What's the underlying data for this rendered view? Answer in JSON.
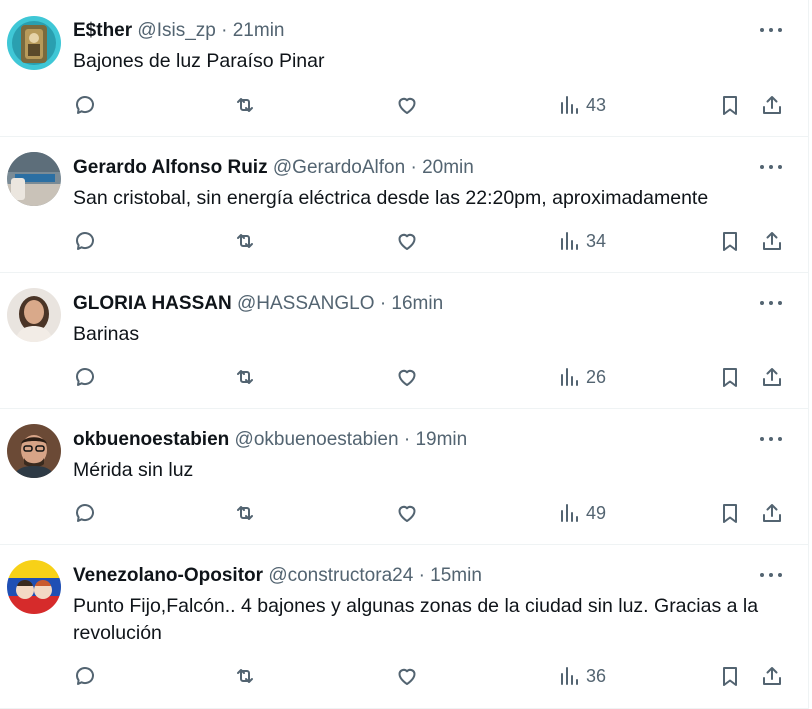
{
  "colors": {
    "text": "#0f1419",
    "secondary": "#536471",
    "divider": "#eff3f4"
  },
  "icons": {
    "reply": "reply-icon",
    "retweet": "retweet-icon",
    "like": "heart-icon",
    "views": "views-icon",
    "bookmark": "bookmark-icon",
    "share": "share-icon",
    "more": "more-icon"
  },
  "tweets": [
    {
      "name": "E$ther",
      "handle": "@Isis_zp",
      "sep": "·",
      "time": "21min",
      "text": "Bajones de luz Paraíso Pinar",
      "views": "43"
    },
    {
      "name": "Gerardo Alfonso Ruiz",
      "handle": "@GerardoAlfon",
      "sep": "·",
      "time": "20min",
      "text": "San cristobal,  sin energía eléctrica desde las 22:20pm, aproximadamente",
      "views": "34"
    },
    {
      "name": "GLORIA HASSAN",
      "handle": "@HASSANGLO",
      "sep": "·",
      "time": "16min",
      "text": "Barinas",
      "views": "26"
    },
    {
      "name": "okbuenoestabien",
      "handle": "@okbuenoestabien",
      "sep": "·",
      "time": "19min",
      "text": "Mérida sin luz",
      "views": "49"
    },
    {
      "name": "Venezolano-Opositor",
      "handle": "@constructora24",
      "sep": "·",
      "time": "15min",
      "text": "Punto Fijo,Falcón.. 4 bajones y algunas zonas de la ciudad sin luz. Gracias a la revolución",
      "views": "36"
    }
  ]
}
